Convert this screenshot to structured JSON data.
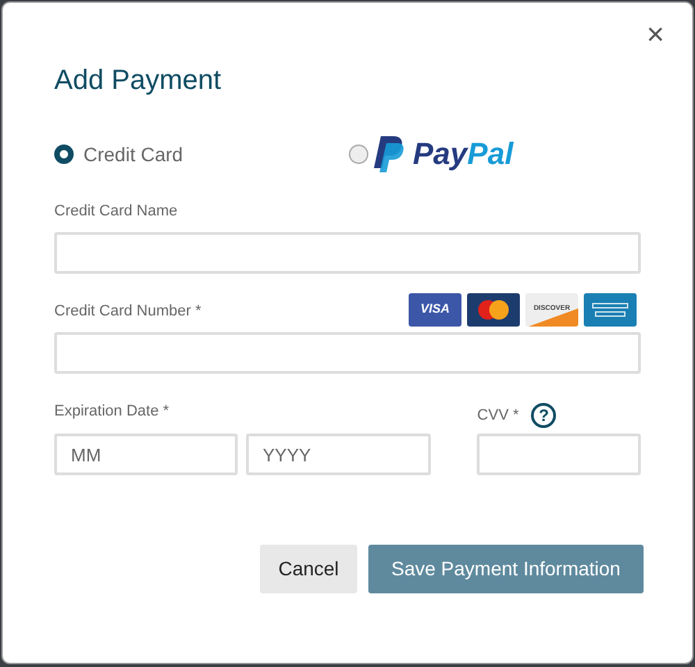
{
  "dialog": {
    "title": "Add Payment",
    "close": "×"
  },
  "payment_methods": [
    {
      "kind": "text",
      "label": "Credit Card",
      "selected": true
    },
    {
      "kind": "paypal",
      "label": "PayPal",
      "selected": false
    }
  ],
  "fields": [
    {
      "label": "Credit Card Name"
    },
    {
      "label": "Credit Card Number *",
      "cards": [
        {
          "kind": "visa",
          "label": "VISA"
        },
        {
          "kind": "mastercard"
        },
        {
          "kind": "discover",
          "label": "DISCOVER"
        },
        {
          "kind": "amex"
        }
      ]
    }
  ],
  "expiration": {
    "label": "Expiration Date *",
    "month_placeholder": "MM",
    "year_placeholder": "YYYY"
  },
  "cvv": {
    "label": "CVV *",
    "help": "?"
  },
  "buttons": [
    {
      "kind": "secondary",
      "label": "Cancel"
    },
    {
      "kind": "primary",
      "label": "Save Payment Information"
    }
  ]
}
